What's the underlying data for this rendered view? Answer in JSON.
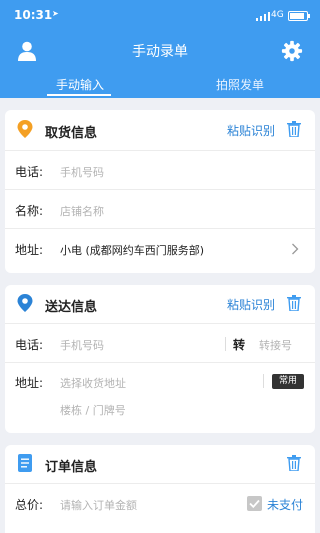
{
  "status": {
    "time": "10:31",
    "network": "4G"
  },
  "header": {
    "title": "手动录单"
  },
  "tabs": [
    {
      "label": "手动输入"
    },
    {
      "label": "拍照发单"
    }
  ],
  "pickup": {
    "title": "取货信息",
    "paste": "粘贴识别",
    "phone_label": "电话:",
    "phone_placeholder": "手机号码",
    "name_label": "名称:",
    "name_placeholder": "店铺名称",
    "address_label": "地址:",
    "address_value": "小电 (成都网约车西门服务部)"
  },
  "delivery": {
    "title": "送达信息",
    "paste": "粘贴识别",
    "phone_label": "电话:",
    "phone_placeholder": "手机号码",
    "ext_label": "转",
    "ext_placeholder": "转接号",
    "address_label": "地址:",
    "address_placeholder": "选择收货地址",
    "common_label": "常用",
    "floor_placeholder": "楼栋 / 门牌号"
  },
  "order": {
    "title": "订单信息",
    "total_label": "总价:",
    "total_placeholder": "请输入订单金额",
    "unpaid_label": "未支付"
  },
  "colors": {
    "header": "#3f9cf0",
    "accent": "#2b83d6",
    "pin_orange": "#f4a024",
    "pin_blue": "#2b83d6",
    "doc_blue": "#3f9cf0"
  }
}
